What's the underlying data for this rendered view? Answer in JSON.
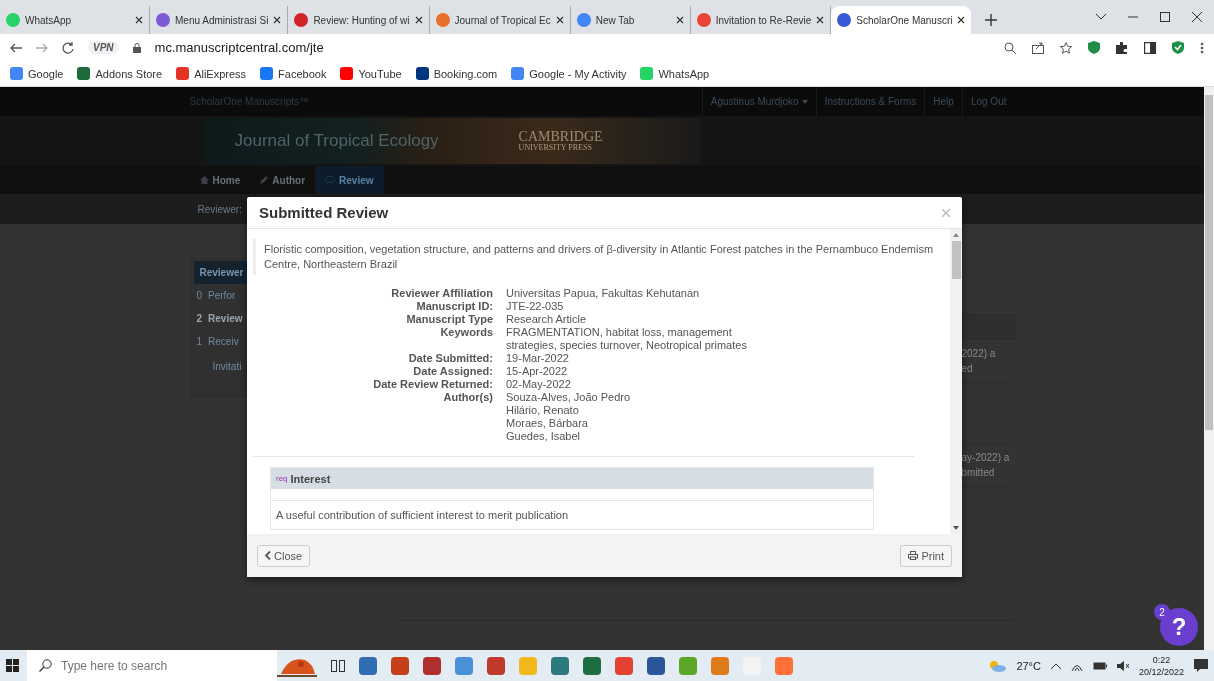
{
  "browser": {
    "tabs": [
      {
        "title": "WhatsApp",
        "color": "#25d366",
        "selected": false
      },
      {
        "title": "Menu Administrasi Si",
        "color": "#7b5cd6",
        "selected": false
      },
      {
        "title": "Review: Hunting of wi",
        "color": "#d2232a",
        "selected": false
      },
      {
        "title": "Journal of Tropical Ec",
        "color": "#e8702a",
        "selected": false
      },
      {
        "title": "New Tab",
        "color": "#4285f4",
        "selected": false
      },
      {
        "title": "Invitation to Re-Revie",
        "color": "#ea4335",
        "selected": false
      },
      {
        "title": "ScholarOne Manuscri",
        "color": "#3a5bd9",
        "selected": true
      }
    ],
    "address": {
      "vpn": "VPN",
      "url": "mc.manuscriptcentral.com/jte"
    },
    "bookmarks": [
      {
        "label": "Google",
        "color": "#4285f4"
      },
      {
        "label": "Addons Store",
        "color": "#1e6b3a"
      },
      {
        "label": "AliExpress",
        "color": "#e43225"
      },
      {
        "label": "Facebook",
        "color": "#1877f2"
      },
      {
        "label": "YouTube",
        "color": "#ff0000"
      },
      {
        "label": "Booking.com",
        "color": "#003580"
      },
      {
        "label": "Google - My Activity",
        "color": "#4285f4"
      },
      {
        "label": "WhatsApp",
        "color": "#25d366"
      }
    ]
  },
  "page": {
    "topbar": {
      "brand": "ScholarOne Manuscripts™",
      "user": "Agustinus Murdjoko",
      "links": [
        "Instructions & Forms",
        "Help",
        "Log Out"
      ]
    },
    "banner": {
      "journal": "Journal of Tropical Ecology",
      "publisher": "CAMBRIDGE",
      "publisher_sub": "UNIVERSITY PRESS"
    },
    "nav": [
      {
        "label": "Home",
        "selected": false
      },
      {
        "label": "Author",
        "selected": false
      },
      {
        "label": "Review",
        "selected": true
      }
    ],
    "subnav": "Reviewer:",
    "left_panel": {
      "title": "Reviewer",
      "items": [
        {
          "count": "0",
          "label": "Perfor",
          "selected": false
        },
        {
          "count": "2",
          "label": "Review",
          "selected": true
        },
        {
          "count": "1",
          "label": "Receiv",
          "selected": false
        }
      ],
      "footer": "Invitati"
    },
    "right_fragments": [
      [
        "2022) a",
        "ed"
      ],
      [
        "ay-2022) a",
        "bmitted"
      ]
    ],
    "help": {
      "icon": "?",
      "badge": "2"
    }
  },
  "modal": {
    "title": "Submitted Review",
    "manuscript_title": "Floristic composition, vegetation structure, and patterns and drivers of β-diversity in Atlantic Forest patches in the Pernambuco Endemism Centre, Northeastern Brazil",
    "details": [
      {
        "label": "Reviewer Affiliation",
        "values": [
          "Universitas Papua, Fakultas Kehutanan"
        ]
      },
      {
        "label": "Manuscript ID:",
        "values": [
          "JTE-22-035"
        ]
      },
      {
        "label": "Manuscript Type",
        "values": [
          "Research Article"
        ]
      },
      {
        "label": "Keywords",
        "values": [
          "FRAGMENTATION, habitat loss, management strategies, species turnover, Neotropical primates"
        ]
      },
      {
        "label": "Date Submitted:",
        "values": [
          "19-Mar-2022"
        ]
      },
      {
        "label": "Date Assigned:",
        "values": [
          "15-Apr-2022"
        ]
      },
      {
        "label": "Date Review Returned:",
        "values": [
          "02-May-2022"
        ]
      },
      {
        "label": "Author(s)",
        "values": [
          "Souza-Alves, João Pedro",
          "Hilário, Renato",
          "Moraes, Bárbara",
          "Guedes, Isabel"
        ]
      }
    ],
    "section": {
      "tag": "req",
      "title": "Interest",
      "answer": "A useful contribution of sufficient interest to merit publication"
    },
    "buttons": {
      "close": "Close",
      "print": "Print"
    }
  },
  "taskbar": {
    "search_placeholder": "Type here to search",
    "apps": [
      {
        "color": "#2f6db5"
      },
      {
        "color": "#c43e1c"
      },
      {
        "color": "#b03030"
      },
      {
        "color": "#4a90d9"
      },
      {
        "color": "#c0392b"
      },
      {
        "color": "#f2b71b"
      },
      {
        "color": "#2c7a7b"
      },
      {
        "color": "#1d6f42"
      },
      {
        "color": "#e34133"
      },
      {
        "color": "#2b579a"
      },
      {
        "color": "#5ba829"
      },
      {
        "color": "#e07b1a"
      },
      {
        "color": "#f4f4f4"
      },
      {
        "color": "#ff7139"
      }
    ],
    "weather": "27°C",
    "time": "0:22",
    "date": "20/12/2022"
  }
}
